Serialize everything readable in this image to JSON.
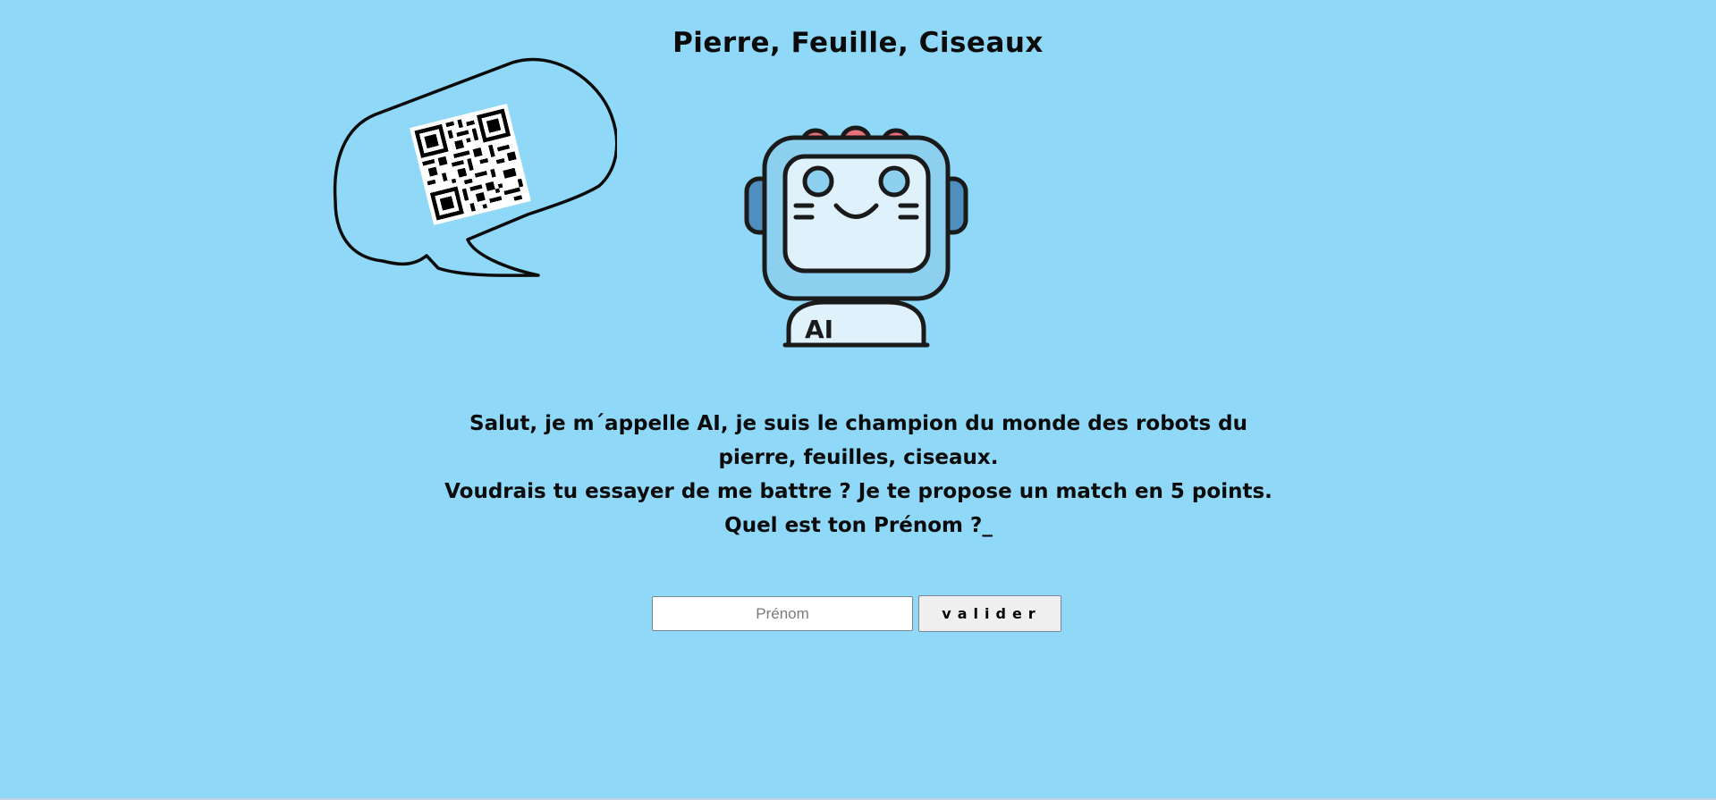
{
  "header": {
    "title": "Pierre, Feuille, Ciseaux"
  },
  "robot": {
    "chest_label": "AI",
    "icon": "robot-icon"
  },
  "qr": {
    "icon": "qr-code-icon"
  },
  "message": {
    "line1": "Salut, je m´appelle AI, je suis le champion du monde des robots du pierre, feuilles, ciseaux.",
    "line2": "Voudrais tu essayer de me battre ? Je te propose un match en 5 points. Quel est ton Prénom ?_"
  },
  "form": {
    "name_placeholder": "Prénom",
    "name_value": "",
    "submit_label": "valider"
  },
  "colors": {
    "background": "#8fd8f7",
    "robot_body": "#8ccfef",
    "robot_screen": "#dff1fb",
    "robot_lights": "#e8707a"
  }
}
